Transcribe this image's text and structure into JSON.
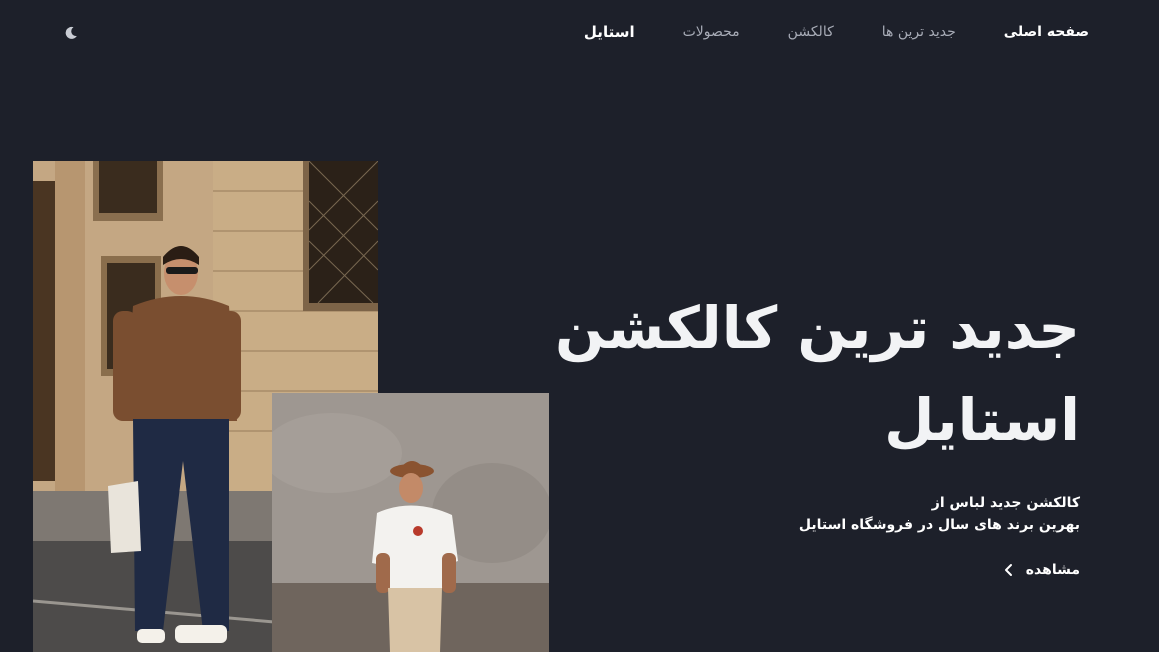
{
  "header": {
    "brand": "استایل",
    "nav": [
      {
        "label": "صفحه اصلی",
        "active": true
      },
      {
        "label": "جدید ترین ها",
        "active": false
      },
      {
        "label": "کالکشن",
        "active": false
      },
      {
        "label": "محصولات",
        "active": false
      }
    ],
    "theme_icon": "moon-icon"
  },
  "hero": {
    "title_line1": "جدید ترین کالکشن",
    "title_line2": "استایل",
    "subtitle_line1": "کالکشن جدید لباس از",
    "subtitle_line2": "بهرین برند های سال در فروشگاه استایل",
    "cta_label": "مشاهده",
    "cta_icon": "chevron-left-icon"
  },
  "images": [
    {
      "name": "model-street-photo"
    },
    {
      "name": "model-wall-photo"
    }
  ],
  "colors": {
    "background": "#1d202a",
    "text": "#ffffff",
    "muted": "#a7abb6"
  }
}
